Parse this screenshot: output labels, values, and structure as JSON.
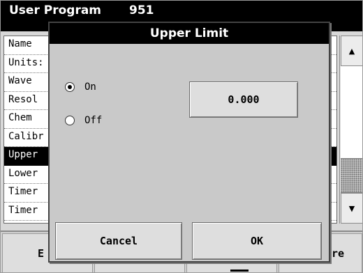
{
  "window": {
    "title": "User Program",
    "program_number": "951"
  },
  "parameter_list": {
    "items": [
      {
        "label": "Name"
      },
      {
        "label": "Units:"
      },
      {
        "label": "Wave"
      },
      {
        "label": "Resol"
      },
      {
        "label": "Chem"
      },
      {
        "label": "Calibr"
      },
      {
        "label": "Upper",
        "selected": true
      },
      {
        "label": "Lower"
      },
      {
        "label": "Timer"
      },
      {
        "label": "Timer"
      }
    ]
  },
  "scrollbar": {
    "up_icon": "triangle-up-icon",
    "down_icon": "triangle-down-icon",
    "up_glyph": "▲",
    "down_glyph": "▼"
  },
  "bottom_bar": {
    "left_label": "E",
    "right_label": "ore"
  },
  "dialog": {
    "title": "Upper Limit",
    "options": [
      {
        "label": "On",
        "selected": true
      },
      {
        "label": "Off",
        "selected": false
      }
    ],
    "value": "0.000",
    "cancel_label": "Cancel",
    "ok_label": "OK"
  },
  "colors": {
    "title_bar": "#000000",
    "selection": "#000000",
    "panel": "#c9c9c9"
  }
}
